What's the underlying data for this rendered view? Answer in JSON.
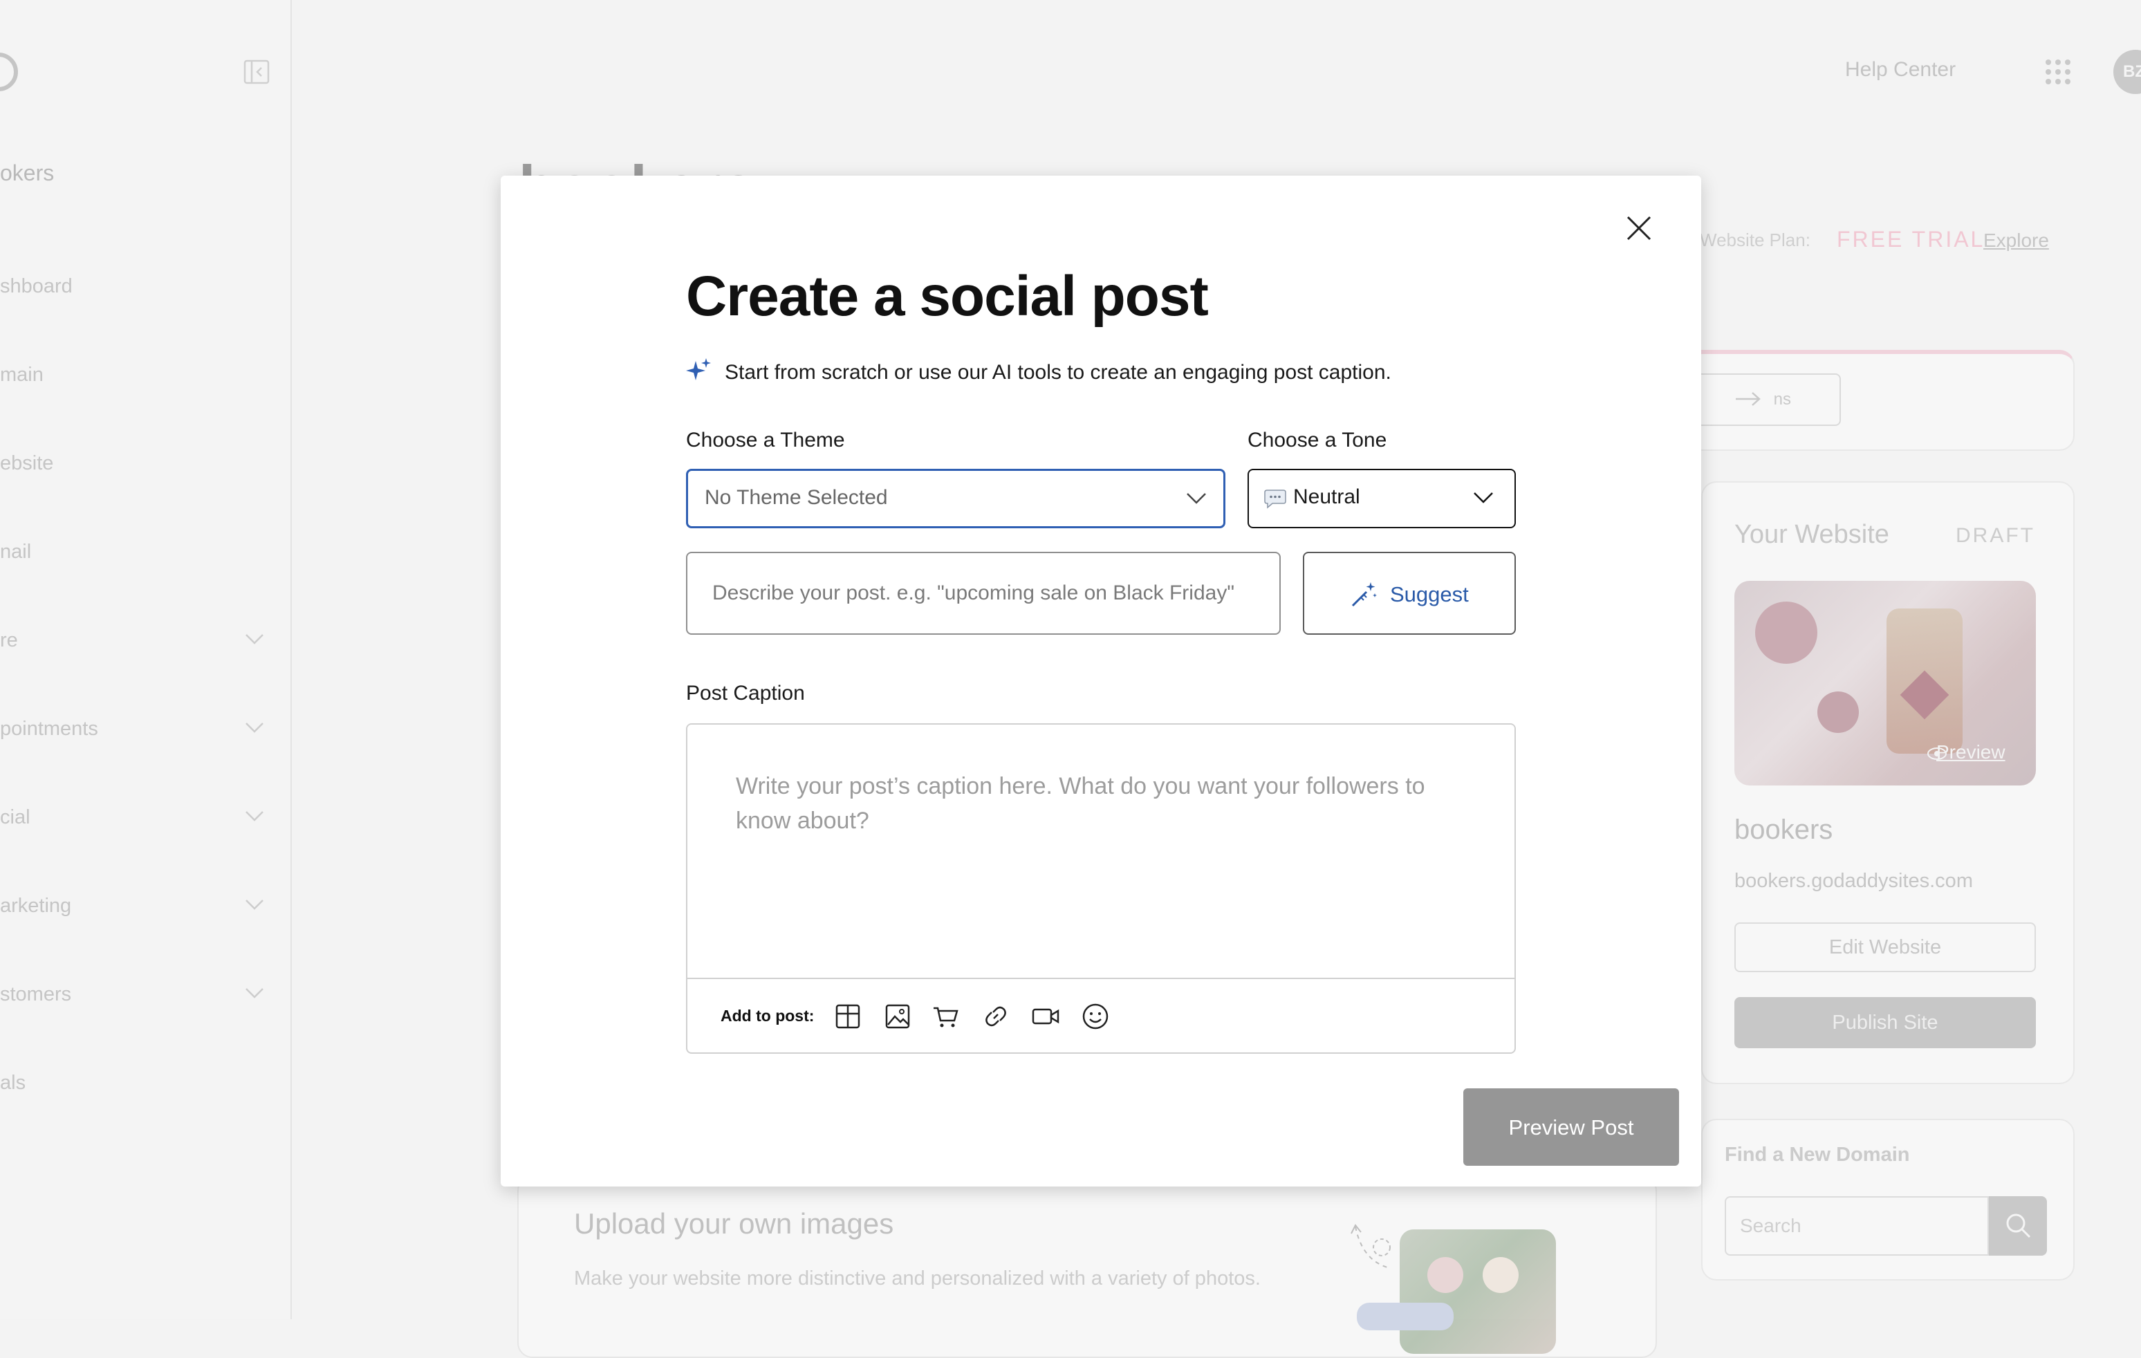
{
  "sidebar": {
    "brand": "okers",
    "items": [
      {
        "label": "shboard",
        "has_chevron": false
      },
      {
        "label": "main",
        "has_chevron": false
      },
      {
        "label": "ebsite",
        "has_chevron": false
      },
      {
        "label": "nail",
        "has_chevron": false
      },
      {
        "label": "re",
        "has_chevron": true
      },
      {
        "label": "pointments",
        "has_chevron": true
      },
      {
        "label": "cial",
        "has_chevron": true
      },
      {
        "label": "arketing",
        "has_chevron": true
      },
      {
        "label": "stomers",
        "has_chevron": true
      },
      {
        "label": "als",
        "has_chevron": false
      }
    ]
  },
  "header": {
    "help_center": "Help Center",
    "avatar_initials": "BZ"
  },
  "background": {
    "page_title": "bookers",
    "plan_label": "Website Plan:",
    "plan_value": "FREE TRIAL",
    "plan_link": "Explore",
    "banner_button": "ns",
    "website_card": {
      "title": "Your Website",
      "status": "DRAFT",
      "preview_link": "Preview",
      "site_name": "bookers",
      "domain": "bookers.godaddysites.com",
      "edit_button": "Edit Website",
      "publish_button": "Publish Site"
    },
    "domain_card": {
      "title": "Find a New Domain",
      "search_placeholder": "Search"
    },
    "upload_card": {
      "title": "Upload your own images",
      "description": "Make your website more distinctive and personalized with a variety of photos."
    }
  },
  "modal": {
    "title": "Create a social post",
    "subtitle": "Start from scratch or use our AI tools to create an engaging post caption.",
    "theme": {
      "label": "Choose a Theme",
      "selected": "No Theme Selected"
    },
    "tone": {
      "label": "Choose a Tone",
      "selected": "Neutral"
    },
    "describe_placeholder": "Describe your post. e.g. \"upcoming sale on Black Friday\"",
    "suggest_button": "Suggest",
    "caption": {
      "label": "Post Caption",
      "placeholder": "Write your post’s caption here. What do you want your followers to know about?",
      "add_to_post_label": "Add to post:",
      "tools": [
        "layout-icon",
        "image-icon",
        "cart-icon",
        "link-icon",
        "video-icon",
        "emoji-icon"
      ]
    },
    "preview_button": "Preview Post"
  },
  "colors": {
    "accent_blue": "#2f5fb3",
    "suggest_text": "#2a5aa8",
    "preview_button_bg": "#969696",
    "plan_value": "#f1c6d2"
  }
}
